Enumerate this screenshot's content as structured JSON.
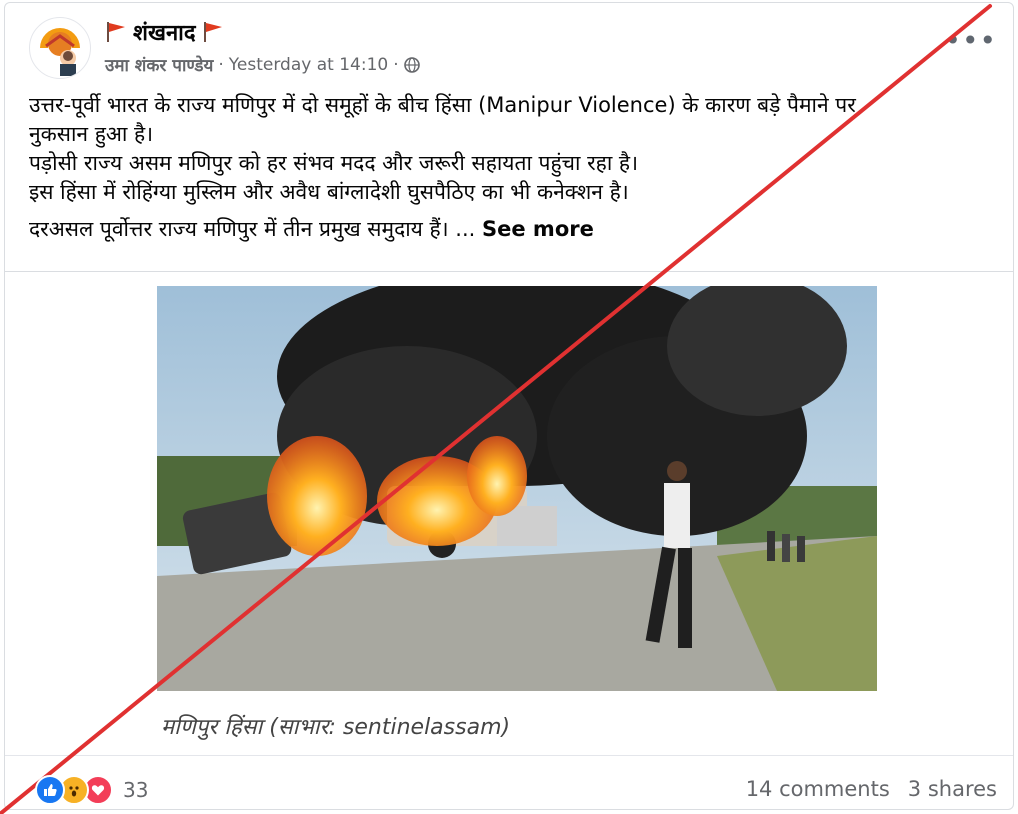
{
  "post": {
    "page_name": "शंखनाद",
    "author": "उमा शंकर पाण्डेय",
    "separator": "·",
    "timestamp": "Yesterday at 14:10",
    "audience_icon": "globe-icon",
    "more_icon": "more-options-icon",
    "more_label": "•••"
  },
  "content": {
    "line1": "उत्तर-पूर्वी भारत के राज्य मणिपुर में दो समूहों के बीच हिंसा (Manipur Violence) के कारण बड़े पैमाने पर",
    "line2": "नुकसान हुआ है।",
    "line3": "पड़ोसी राज्य असम मणिपुर को हर संभव मदद और जरूरी सहायता पहुंचा रहा है।",
    "line4": "इस हिंसा में रोहिंग्या मुस्लिम और अवैध बांग्लादेशी घुसपैठिए का भी कनेक्शन है।",
    "line5": "दरअसल पूर्वोत्तर राज्य मणिपुर में तीन प्रमुख समुदाय हैं। ...",
    "see_more": "See more"
  },
  "media": {
    "caption": "मणिपुर हिंसा (साभार: sentinelassam)"
  },
  "footer": {
    "reaction_icons": [
      "like-icon",
      "wow-icon",
      "love-icon"
    ],
    "reaction_count": "33",
    "comments": "14 comments",
    "shares": "3 shares"
  },
  "colors": {
    "cross": "#e03131",
    "flag": "#e03b1f",
    "like": "#1877f2",
    "wow": "#f7b125",
    "love": "#f33e58"
  }
}
